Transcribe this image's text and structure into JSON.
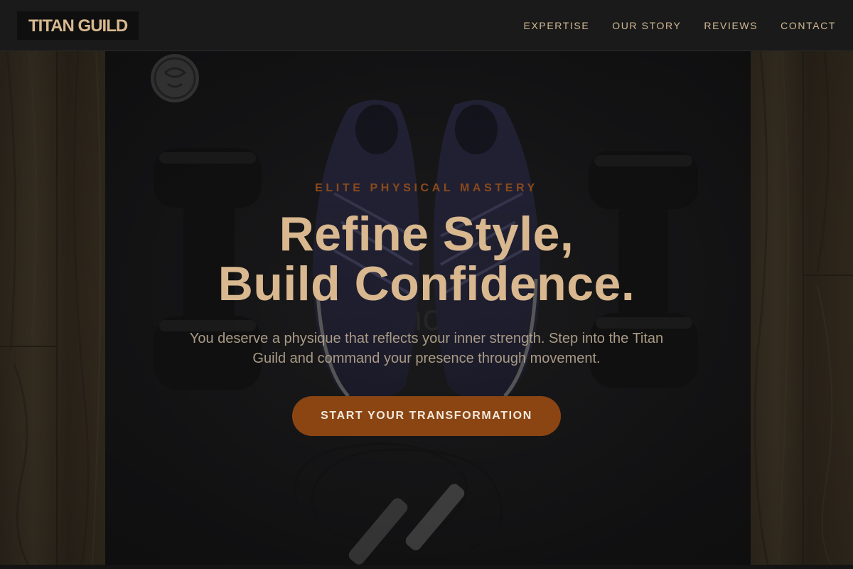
{
  "brand": {
    "logo_text": "TITAN GUILD"
  },
  "nav": {
    "links": [
      {
        "label": "EXPERTISE"
      },
      {
        "label": "OUR STORY"
      },
      {
        "label": "REVIEWS"
      },
      {
        "label": "CONTACT"
      }
    ]
  },
  "hero": {
    "eyebrow": "ELITE PHYSICAL MASTERY",
    "headline_line1": "Refine Style,",
    "headline_line2": "Build Confidence.",
    "subtitle": "You deserve a physique that reflects your inner strength. Step into the Titan Guild and command your presence through movement.",
    "cta_label": "START YOUR TRANSFORMATION",
    "background_image": {
      "description": "Overhead photo of a dark yoga mat on a wooden floor with a pair of navy running shoes, two black dumbbells and a jump rope",
      "mat_print_text": "macho love"
    }
  },
  "colors": {
    "accent": "#8b4513",
    "headline": "#d9b88f",
    "nav_text": "#d2b994",
    "eyebrow": "#8b4a1c",
    "nav_bg": "#1a1a1a"
  }
}
